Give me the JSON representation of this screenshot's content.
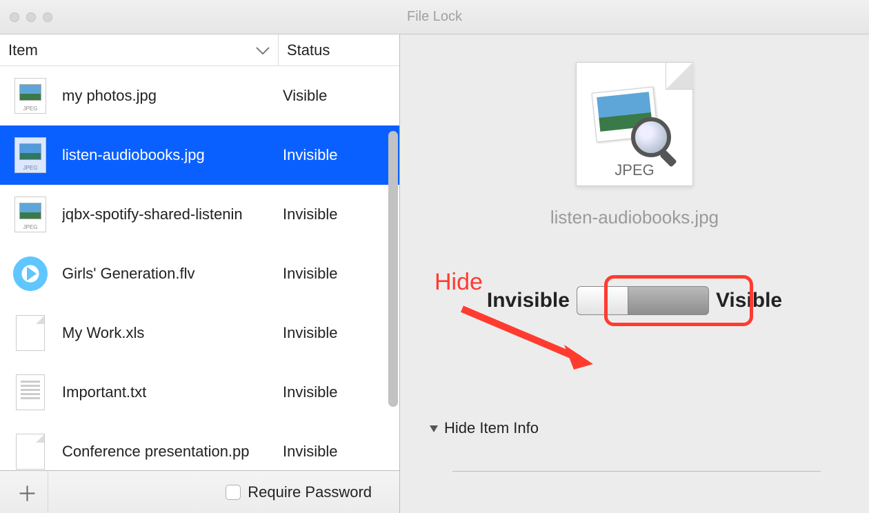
{
  "window": {
    "title": "File Lock"
  },
  "columns": {
    "item": "Item",
    "status": "Status"
  },
  "files": [
    {
      "name": "my photos.jpg",
      "status": "Visible",
      "icon": "jpeg"
    },
    {
      "name": "listen-audiobooks.jpg",
      "status": "Invisible",
      "icon": "jpeg",
      "selected": true
    },
    {
      "name": "jqbx-spotify-shared-listenin",
      "status": "Invisible",
      "icon": "jpeg"
    },
    {
      "name": "Girls' Generation.flv",
      "status": "Invisible",
      "icon": "video"
    },
    {
      "name": "My Work.xls",
      "status": "Invisible",
      "icon": "doc"
    },
    {
      "name": "Important.txt",
      "status": "Invisible",
      "icon": "txt"
    },
    {
      "name": "Conference presentation.pp",
      "status": "Invisible",
      "icon": "doc"
    }
  ],
  "bottom": {
    "require_password": "Require Password"
  },
  "detail": {
    "icon_type": "JPEG",
    "filename": "listen-audiobooks.jpg",
    "invisible": "Invisible",
    "visible": "Visible",
    "hide_info": "Hide Item Info"
  },
  "annotation": {
    "hide": "Hide"
  }
}
